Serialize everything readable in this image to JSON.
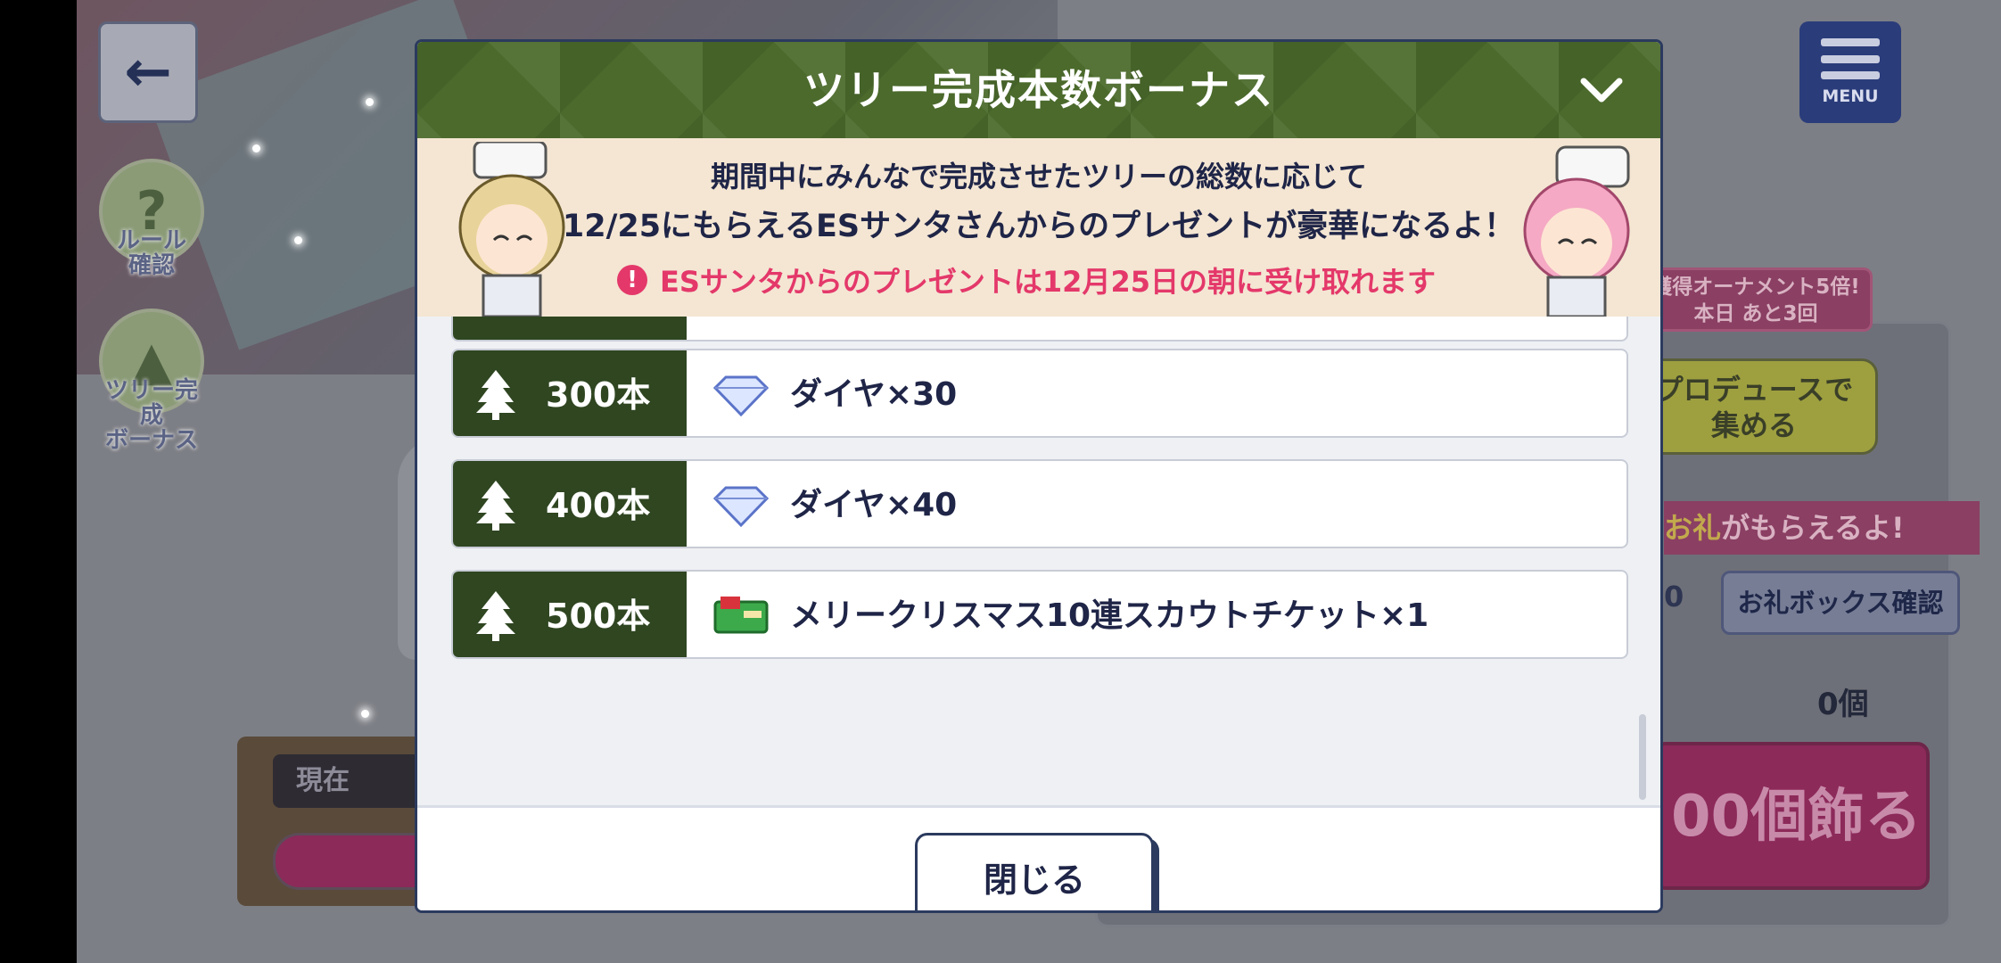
{
  "background": {
    "side_buttons": [
      {
        "label": "ルール\n確認",
        "icon": "question-icon"
      },
      {
        "label": "ツリー完成\nボーナス",
        "icon": "tree-icon"
      }
    ],
    "menu_label": "MENU",
    "ornament_badge": {
      "line1": "獲得オーナメント5倍!",
      "line2": "本日 あと3回"
    },
    "produce_button": "プロデュースで\n集める",
    "ofuda_notice": {
      "prefix": "お礼",
      "suffix": "がもらえるよ!"
    },
    "ofuda_box_button": "お礼ボックス確認",
    "count_small": "0",
    "count_items": "0個",
    "decorate_button": "00個飾る",
    "current_label": "現在"
  },
  "modal": {
    "title": "ツリー完成本数ボーナス",
    "info": {
      "line1": "期間中にみんなで完成させたツリーの総数に応じて",
      "line2": "12/25にもらえるESサンタさんからのプレゼントが豪華になるよ！",
      "warning": "ESサンタからのプレゼントは12月25日の朝に受け取れます"
    },
    "rewards": [
      {
        "count": "300本",
        "reward": "ダイヤ×30",
        "icon": "diamond-icon"
      },
      {
        "count": "400本",
        "reward": "ダイヤ×40",
        "icon": "diamond-icon"
      },
      {
        "count": "500本",
        "reward": "メリークリスマス10連スカウトチケット×1",
        "icon": "ticket-icon"
      }
    ],
    "close_button": "閉じる"
  },
  "colors": {
    "header_green": "#4b6a2c",
    "tag_green": "#2f4621",
    "warning_pink": "#e4386a",
    "text_navy": "#1f2547"
  }
}
